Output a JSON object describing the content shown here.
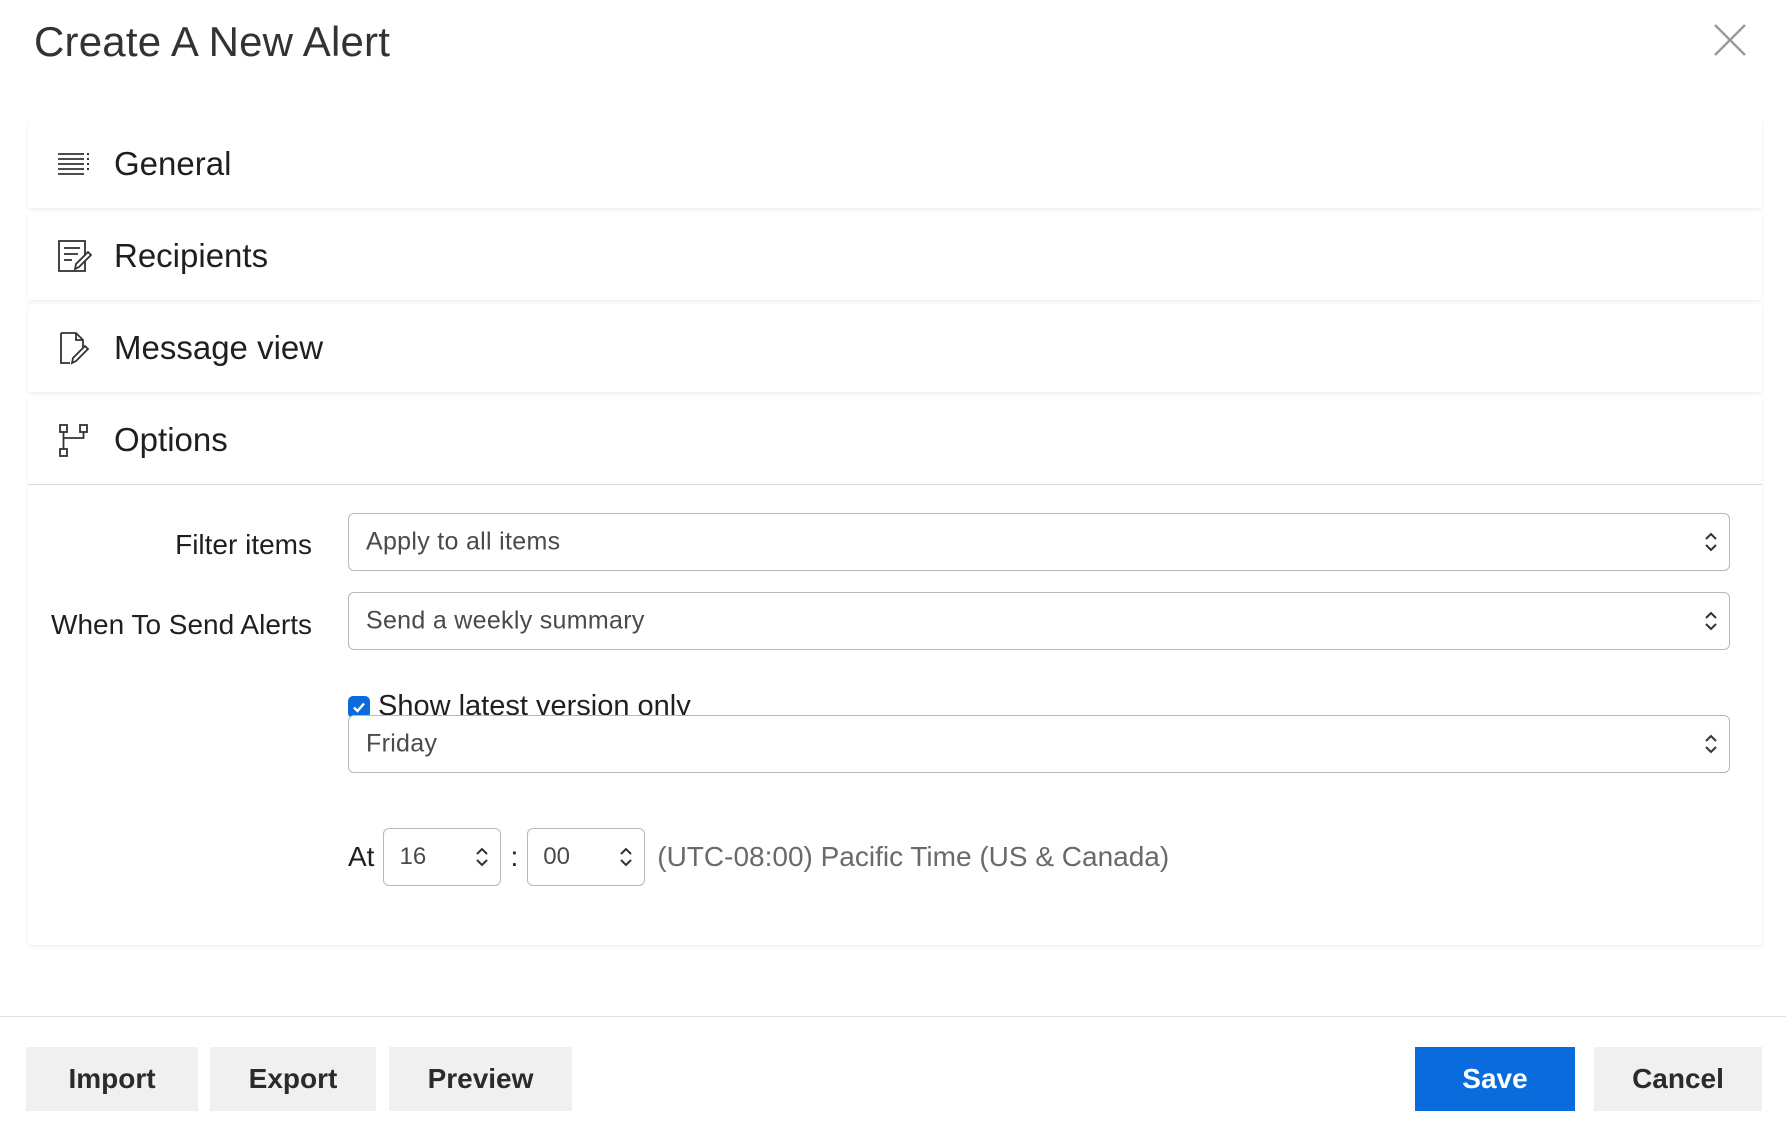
{
  "dialog": {
    "title": "Create A New Alert"
  },
  "sections": [
    {
      "label": "General",
      "icon": "list-icon"
    },
    {
      "label": "Recipients",
      "icon": "edit-list-icon"
    },
    {
      "label": "Message view",
      "icon": "edit-document-icon"
    },
    {
      "label": "Options",
      "icon": "flowchart-icon"
    }
  ],
  "options": {
    "filter_label": "Filter items",
    "filter_value": "Apply to all items",
    "when_label": "When To Send Alerts",
    "when_value": "Send a weekly summary",
    "latest_only_label": "Show latest version only",
    "latest_only_checked": true,
    "day_value": "Friday",
    "at_label": "At",
    "hour_value": "16",
    "time_separator": ":",
    "minute_value": "00",
    "timezone": "(UTC-08:00) Pacific Time (US & Canada)"
  },
  "footer": {
    "import_label": "Import",
    "export_label": "Export",
    "preview_label": "Preview",
    "save_label": "Save",
    "cancel_label": "Cancel"
  },
  "colors": {
    "accent": "#0a6cdc",
    "button_bg": "#f0f0f0",
    "border": "#b8b8b8"
  }
}
